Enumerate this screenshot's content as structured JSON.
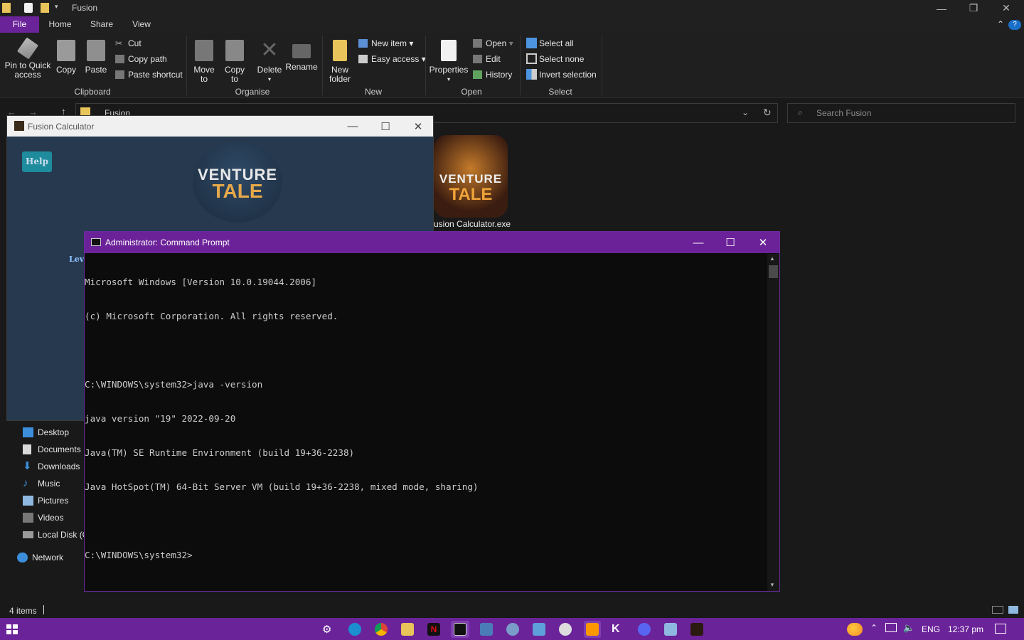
{
  "explorer": {
    "title": "Fusion",
    "tabs": [
      "File",
      "Home",
      "Share",
      "View"
    ],
    "ribbon": {
      "pin_label_1": "Pin to Quick",
      "pin_label_2": "access",
      "copy": "Copy",
      "paste": "Paste",
      "cut": "Cut",
      "copy_path": "Copy path",
      "paste_shortcut": "Paste shortcut",
      "move_to_1": "Move",
      "move_to_2": "to",
      "copy_to_1": "Copy",
      "copy_to_2": "to",
      "delete": "Delete",
      "rename": "Rename",
      "new_folder_1": "New",
      "new_folder_2": "folder",
      "new_item": "New item",
      "easy_access": "Easy access",
      "properties": "Properties",
      "open": "Open",
      "edit": "Edit",
      "history": "History",
      "select_all": "Select all",
      "select_none": "Select none",
      "invert_selection": "Invert selection",
      "groups": {
        "clipboard": "Clipboard",
        "organise": "Organise",
        "new": "New",
        "open": "Open",
        "select": "Select"
      }
    },
    "address": {
      "folder": "Fusion",
      "search_placeholder": "Search Fusion"
    },
    "nav": [
      "Desktop",
      "Documents",
      "Downloads",
      "Music",
      "Pictures",
      "Videos",
      "Local Disk (C",
      "Network"
    ],
    "file_label": "usion Calculator.exe",
    "status": "4 items"
  },
  "fusion_calc": {
    "title": "Fusion Calculator",
    "help_button": "Help",
    "logo_top": "VENTURE",
    "logo_bottom": "TALE",
    "partial_label": "Leve"
  },
  "cmd": {
    "title": "Administrator: Command Prompt",
    "lines": [
      "Microsoft Windows [Version 10.0.19044.2006]",
      "(c) Microsoft Corporation. All rights reserved.",
      "",
      "C:\\WINDOWS\\system32>java -version",
      "java version \"19\" 2022-09-20",
      "Java(TM) SE Runtime Environment (build 19+36-2238)",
      "Java HotSpot(TM) 64-Bit Server VM (build 19+36-2238, mixed mode, sharing)",
      "",
      "C:\\WINDOWS\\system32>"
    ]
  },
  "taskbar": {
    "language": "ENG",
    "time": "12:37 pm"
  },
  "colors": {
    "accent": "#6b2399",
    "cmd_title": "#6b2299",
    "file_tab": "#6b2399",
    "fusion_bg": "#26394f"
  }
}
